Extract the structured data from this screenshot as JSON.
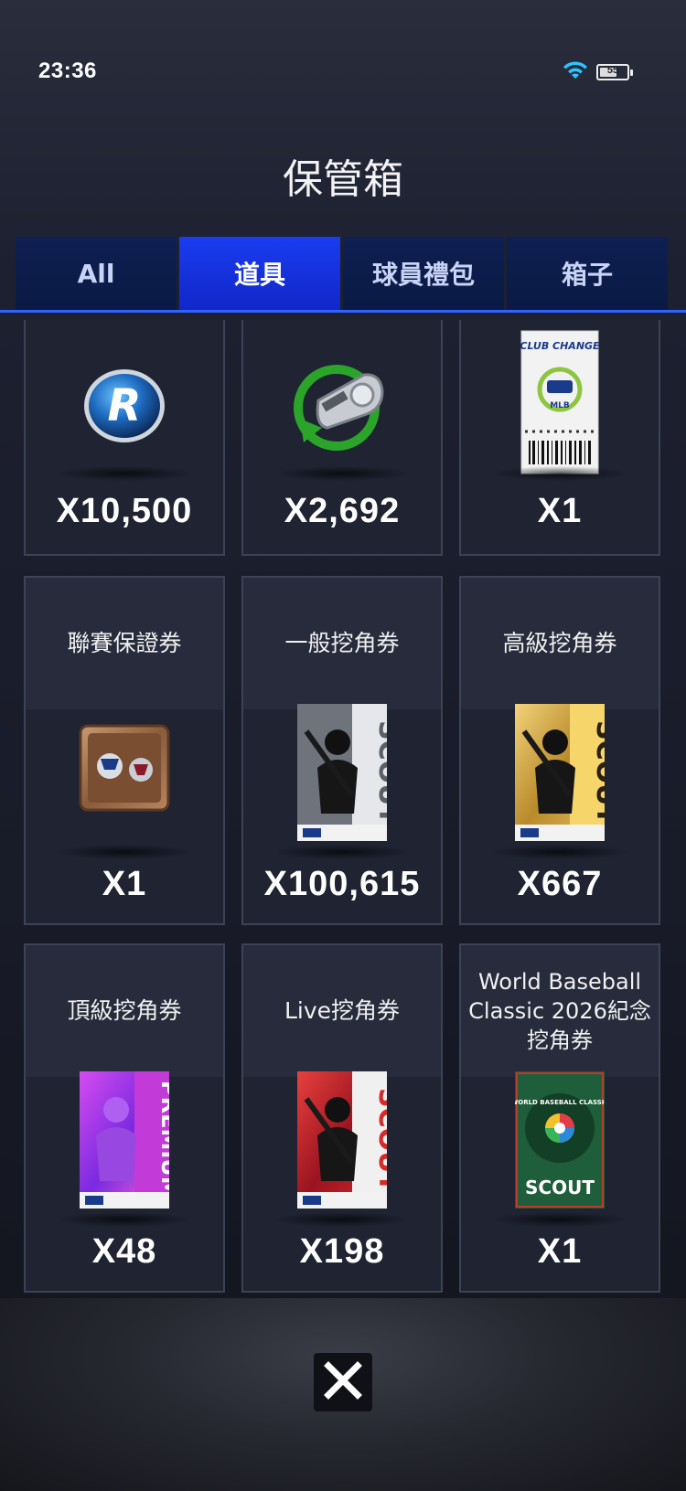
{
  "status_bar": {
    "time": "23:36",
    "battery": "55",
    "battery_fraction": 0.55
  },
  "header": {
    "title": "保管箱"
  },
  "tabs": [
    {
      "label": "All",
      "active": false
    },
    {
      "label": "道具",
      "active": true
    },
    {
      "label": "球員禮包",
      "active": false
    },
    {
      "label": "箱子",
      "active": false
    }
  ],
  "items": [
    {
      "label": "",
      "count": "X10,500",
      "icon": "r-coin-icon"
    },
    {
      "label": "",
      "count": "X2,692",
      "icon": "whistle-refresh-icon"
    },
    {
      "label": "",
      "count": "X1",
      "icon": "club-change-ticket-icon",
      "ticket_title": "CLUB CHANGE",
      "ticket_logo": "MLB"
    },
    {
      "label": "聯賽保證券",
      "count": "X1",
      "icon": "league-guarantee-icon"
    },
    {
      "label": "一般挖角券",
      "count": "X100,615",
      "icon": "scout-card-gray-icon",
      "card_text": "SCOUT"
    },
    {
      "label": "高級挖角券",
      "count": "X667",
      "icon": "scout-card-gold-icon",
      "card_text": "SCOUT"
    },
    {
      "label": "頂級挖角券",
      "count": "X48",
      "icon": "scout-card-premium-icon",
      "card_text": "PREMIUM"
    },
    {
      "label": "Live挖角券",
      "count": "X198",
      "icon": "scout-card-red-icon",
      "card_text": "SCOUT"
    },
    {
      "label": "World Baseball Classic 2026紀念挖角券",
      "count": "X1",
      "icon": "wbc-scout-card-icon",
      "card_text": "SCOUT",
      "badge_text": "WORLD BASEBALL CLASSIC"
    }
  ],
  "colors": {
    "tab_active": "#1a3cf0",
    "tab_inactive": "#0e1f52",
    "card_bg": "#242838",
    "card_border": "#3c4356"
  },
  "close": {
    "icon": "close-icon"
  }
}
